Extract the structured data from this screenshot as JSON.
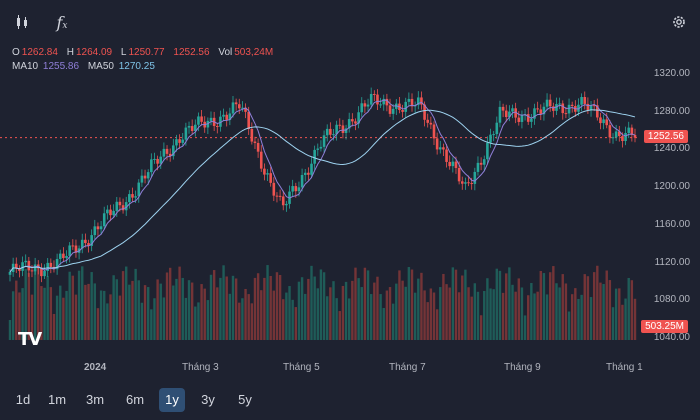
{
  "toolbar": {
    "icons": [
      "candlestick-icon",
      "function-fx-icon",
      "gear-icon"
    ],
    "fx_label": "f",
    "fx_sub": "x"
  },
  "legend": {
    "o_label": "O",
    "o_value": "1262.84",
    "h_label": "H",
    "h_value": "1264.09",
    "l_label": "L",
    "l_value": "1250.77",
    "c_value": "1252.56",
    "vol_label": "Vol",
    "vol_value": "503,24M",
    "ma10_label": "MA10",
    "ma10_value": "1255.86",
    "ma50_label": "MA50",
    "ma50_value": "1270.25"
  },
  "price_axis": [
    "1320.00",
    "1280.00",
    "1240.00",
    "1200.00",
    "1160.00",
    "1120.00",
    "1080.00",
    "1040.00"
  ],
  "current_price_tag": "1252.56",
  "volume_tag": "503.25M",
  "time_axis": [
    "2024",
    "Tháng 3",
    "Tháng 5",
    "Tháng 7",
    "Tháng 9",
    "Tháng 1"
  ],
  "logo_text": "TV",
  "timeframes": {
    "items": [
      "1d",
      "1m",
      "3m",
      "6m",
      "1y",
      "3y",
      "5y"
    ],
    "selected": "1y"
  },
  "colors": {
    "up": "#26a69a",
    "down": "#ef5350",
    "ma10": "#8f7fd8",
    "ma50": "#9ed3f0",
    "background": "#1e2230",
    "selected_tf": "#2f4f74"
  },
  "chart_data": {
    "type": "candlestick",
    "period": "1y",
    "ylim": [
      1040,
      1330
    ],
    "yticks": [
      1040,
      1080,
      1120,
      1160,
      1200,
      1240,
      1280,
      1320
    ],
    "last_close": 1252.56,
    "last_volume": "503.25M",
    "close_trend": [
      {
        "x": "2024 start",
        "y": 1110
      },
      {
        "x": "Jan 2024",
        "y": 1120
      },
      {
        "x": "Feb 2024",
        "y": 1180
      },
      {
        "x": "Mar 2024",
        "y": 1255
      },
      {
        "x": "Apr 2024",
        "y": 1285
      },
      {
        "x": "Apr 2024 low",
        "y": 1175
      },
      {
        "x": "May 2024",
        "y": 1245
      },
      {
        "x": "Jun 2024",
        "y": 1290
      },
      {
        "x": "Jul 2024",
        "y": 1285
      },
      {
        "x": "Aug 2024 low",
        "y": 1195
      },
      {
        "x": "Aug 2024",
        "y": 1275
      },
      {
        "x": "Sep 2024",
        "y": 1280
      },
      {
        "x": "Oct 2024",
        "y": 1290
      },
      {
        "x": "Nov 2024",
        "y": 1258
      },
      {
        "x": "Dec 2024",
        "y": 1252.56
      }
    ],
    "series": [
      {
        "name": "MA10",
        "last": 1255.86
      },
      {
        "name": "MA50",
        "last": 1270.25
      }
    ]
  }
}
